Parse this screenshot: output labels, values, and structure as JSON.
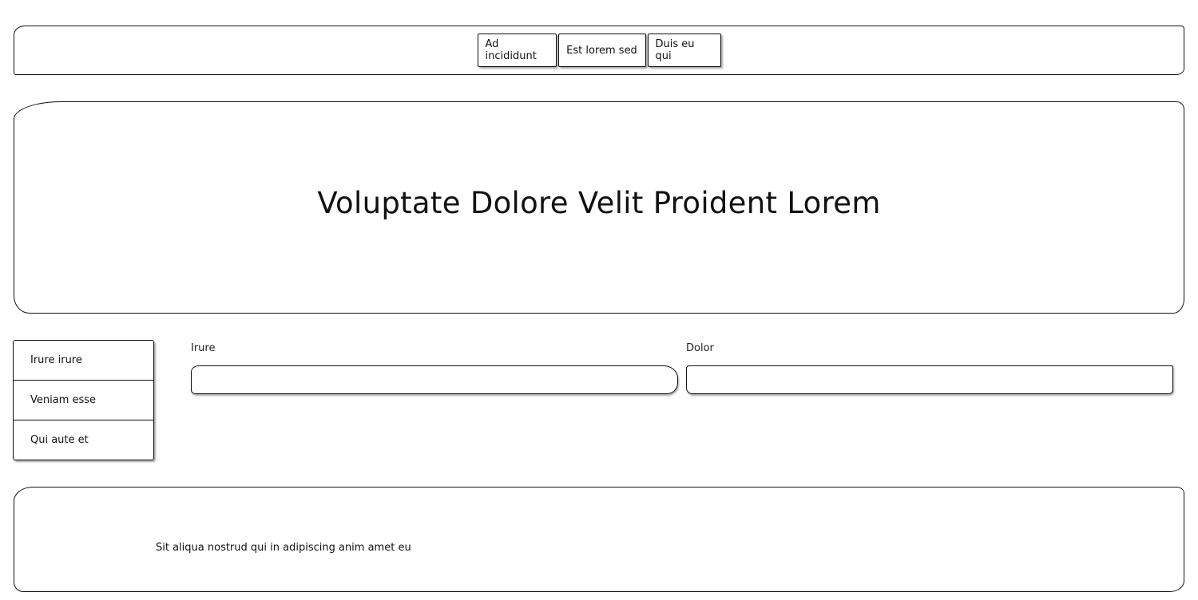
{
  "nav": {
    "buttons": [
      {
        "label": "Ad incididunt"
      },
      {
        "label": "Est lorem sed"
      },
      {
        "label": "Duis eu qui"
      }
    ]
  },
  "hero": {
    "title": "Voluptate Dolore Velit Proident Lorem"
  },
  "side_menu": {
    "items": [
      {
        "label": "Irure irure"
      },
      {
        "label": "Veniam esse"
      },
      {
        "label": "Qui aute et"
      }
    ]
  },
  "form": {
    "fields": [
      {
        "label": "Irure",
        "value": "",
        "placeholder": ""
      },
      {
        "label": "Dolor",
        "value": "",
        "placeholder": ""
      }
    ]
  },
  "footer": {
    "text": "Sit aliqua nostrud qui in adipiscing anim amet eu"
  }
}
